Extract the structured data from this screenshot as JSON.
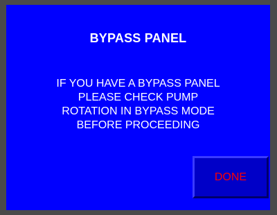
{
  "panel": {
    "title": "BYPASS PANEL",
    "message_lines": [
      "IF YOU HAVE A BYPASS PANEL",
      "PLEASE CHECK PUMP",
      "ROTATION IN BYPASS MODE",
      "BEFORE PROCEEDING"
    ],
    "done_label": "DONE"
  },
  "colors": {
    "background": "#0000ff",
    "frame": "#4a4a4a",
    "text": "#ffffff",
    "button_text": "#ff0000"
  }
}
